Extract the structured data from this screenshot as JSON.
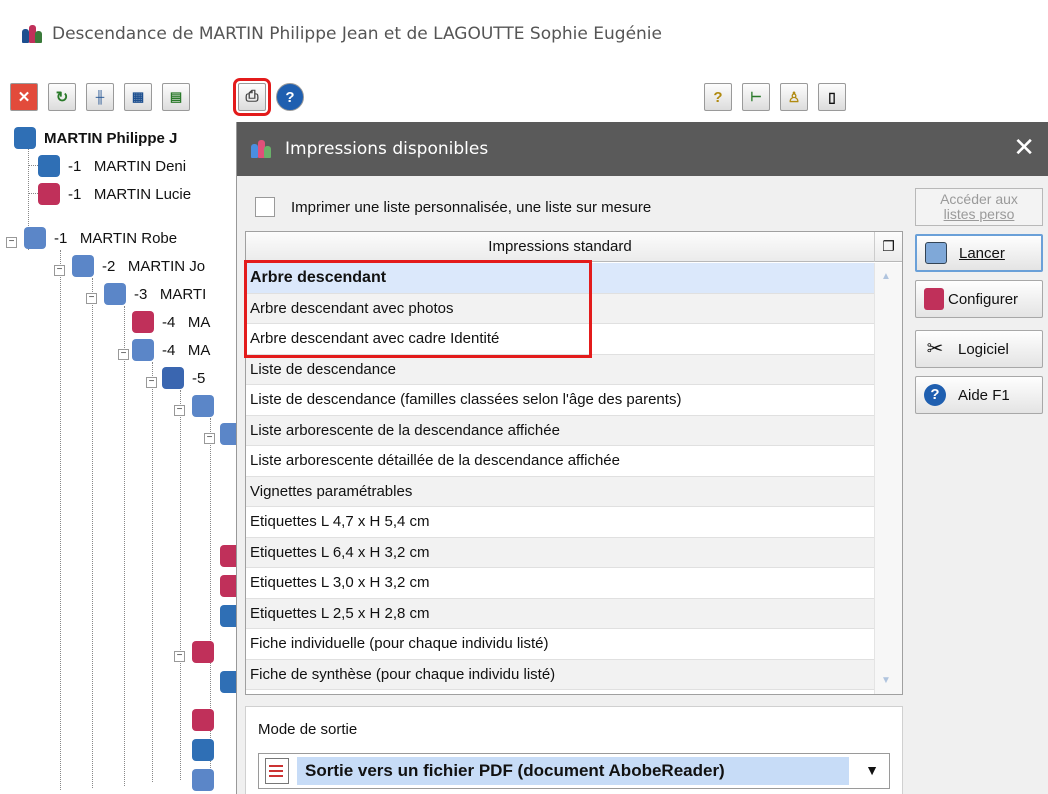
{
  "window": {
    "title": "Descendance de  MARTIN Philippe Jean  et de  LAGOUTTE Sophie Eugénie"
  },
  "toolbar": {
    "left_icons": [
      "close-red-icon",
      "refresh-icon",
      "sliders-icon",
      "grid-icon",
      "spreadsheet-icon",
      "printer-icon",
      "help-icon"
    ],
    "right_icons": [
      "question-mark-icon",
      "tree-icon",
      "stamp-icon",
      "panel-icon"
    ]
  },
  "tree": {
    "root": "MARTIN Philippe J",
    "items": [
      {
        "gen": "-1",
        "name": "MARTIN Deni",
        "sex": "m"
      },
      {
        "gen": "-1",
        "name": "MARTIN Lucie",
        "sex": "f"
      },
      {
        "gen": "-1",
        "name": "MARTIN Robe",
        "sex": "m"
      },
      {
        "gen": "-2",
        "name": "MARTIN Jo",
        "sex": "m"
      },
      {
        "gen": "-3",
        "name": "MARTI",
        "sex": "m"
      },
      {
        "gen": "-4",
        "name": "MA",
        "sex": "f"
      },
      {
        "gen": "-4",
        "name": "MA",
        "sex": "m"
      },
      {
        "gen": "-5",
        "name": "",
        "sex": "m"
      }
    ]
  },
  "dialog": {
    "title": "Impressions disponibles",
    "close": "✕",
    "custom_checkbox_label": "Imprimer une liste personnalisée, une liste sur mesure",
    "list_header": "Impressions standard",
    "list_items": [
      "Arbre descendant",
      "Arbre descendant avec photos",
      "Arbre descendant avec cadre Identité",
      "Liste de descendance",
      "Liste de descendance (familles classées selon l'âge des parents)",
      "Liste arborescente de la descendance affichée",
      "Liste arborescente détaillée de la descendance affichée",
      "Vignettes paramétrables",
      "Etiquettes L 4,7 x H 5,4 cm",
      "Etiquettes L 6,4 x H 3,2 cm",
      "Etiquettes L 3,0 x H 3,2 cm",
      "Etiquettes L 2,5 x H 2,8 cm",
      "Fiche individuelle (pour chaque individu listé)",
      "Fiche de synthèse (pour chaque individu listé)"
    ],
    "selected_index": 0,
    "buttons": {
      "acceder_line1": "Accéder aux",
      "acceder_line2": "listes perso",
      "lancer": "Lancer",
      "configurer": "Configurer",
      "logiciel": "Logiciel",
      "aide": "Aide  F1"
    },
    "output_mode": {
      "label": "Mode de sortie",
      "selected": "Sortie vers un fichier PDF (document AbobeReader)"
    }
  },
  "colors": {
    "dialog_title_bg": "#5a5a5a",
    "highlight_red": "#e31b1b",
    "selection_blue": "#dbe8fb",
    "male_blue": "#2f6fb5",
    "female_pink": "#c0305a"
  }
}
